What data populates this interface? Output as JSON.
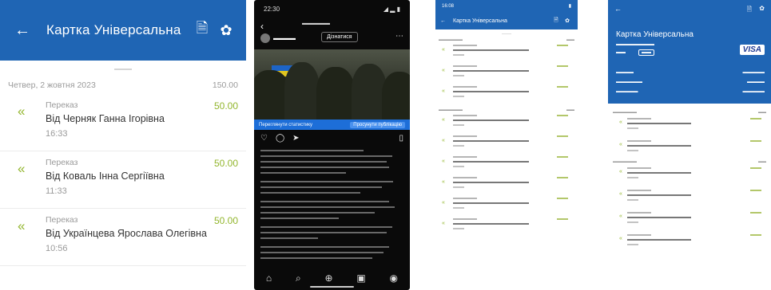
{
  "colors": {
    "brand": "#1f65b4",
    "amount": "#93b62e",
    "muted": "#9a9a9a"
  },
  "panelA": {
    "header": {
      "back_icon": "←",
      "title": "Картка Універсальна",
      "doc_icon": "🗎",
      "gear_icon": "✿"
    },
    "date_group": {
      "label": "Четвер, 2 жовтня 2023",
      "total": "150.00"
    },
    "items": [
      {
        "type": "Переказ",
        "name": "Від Черняк Ганна Ігорівна",
        "time": "16:33",
        "amount": "50.00"
      },
      {
        "type": "Переказ",
        "name": "Від Коваль Інна Сергіївна",
        "time": "11:33",
        "amount": "50.00"
      },
      {
        "type": "Переказ",
        "name": "Від Українцева Ярослава Олегівна",
        "time": "10:56",
        "amount": "50.00"
      }
    ]
  },
  "panelB": {
    "status_time": "22:30",
    "status_icons": "◢ ▂ ▮",
    "back_icon": "‹",
    "follow_label": "Дізнатися",
    "cta_left": "Переглянути статистику",
    "cta_right": "Просунути публікацію",
    "nav_icons": [
      "⌂",
      "⌕",
      "⊕",
      "▣",
      "◉"
    ]
  },
  "panelC": {
    "status_time": "16:08",
    "status_right": "▮",
    "header": {
      "back_icon": "←",
      "title": "Картка Універсальна",
      "doc_icon": "🗎",
      "gear_icon": "✿"
    }
  },
  "panelD": {
    "header": {
      "back_icon": "←",
      "doc_icon": "🗎",
      "gear_icon": "✿"
    },
    "card": {
      "name": "Картка Універсальна",
      "visa": "VISA"
    }
  }
}
